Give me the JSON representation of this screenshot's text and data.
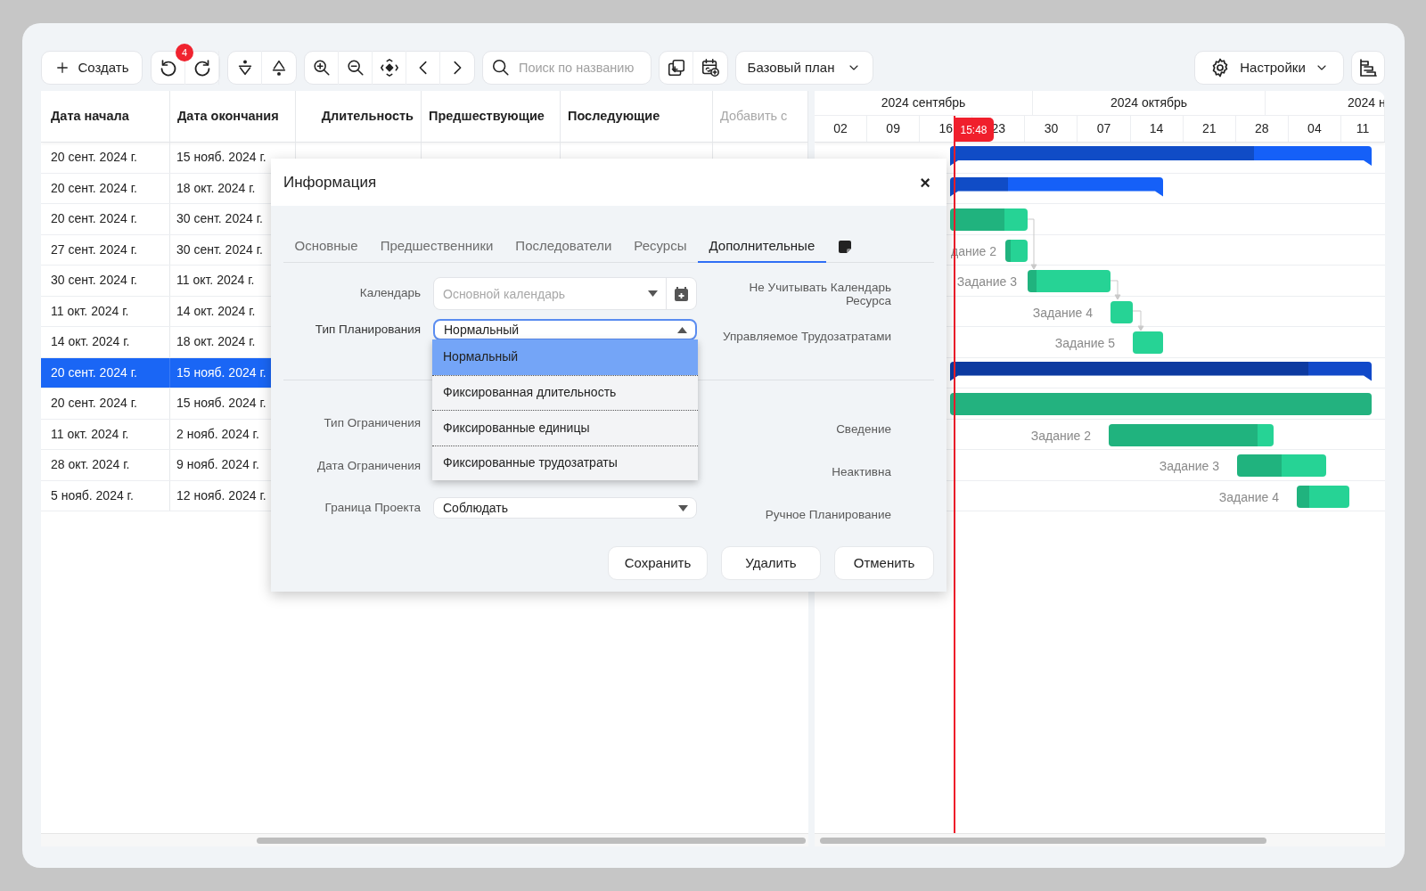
{
  "toolbar": {
    "create": "Создать",
    "undo_badge": "4",
    "search": {
      "placeholder": "Поиск по названию"
    },
    "baseline": "Базовый план",
    "settings": "Настройки"
  },
  "grid": {
    "columns": [
      "Дата начала",
      "Дата окончания",
      "Длительность",
      "Предшествующие",
      "Последующие",
      "Добавить с"
    ],
    "rows": [
      {
        "start": "20 сент. 2024 г.",
        "end": "15 нояб. 2024 г.",
        "selected": false
      },
      {
        "start": "20 сент. 2024 г.",
        "end": "18 окт. 2024 г.",
        "selected": false
      },
      {
        "start": "20 сент. 2024 г.",
        "end": "30 сент. 2024 г.",
        "selected": false
      },
      {
        "start": "27 сент. 2024 г.",
        "end": "30 сент. 2024 г.",
        "selected": false
      },
      {
        "start": "30 сент. 2024 г.",
        "end": "11 окт. 2024 г.",
        "selected": false
      },
      {
        "start": "11 окт. 2024 г.",
        "end": "14 окт. 2024 г.",
        "selected": false
      },
      {
        "start": "14 окт. 2024 г.",
        "end": "18 окт. 2024 г.",
        "selected": false
      },
      {
        "start": "20 сент. 2024 г.",
        "end": "15 нояб. 2024 г.",
        "selected": true
      },
      {
        "start": "20 сент. 2024 г.",
        "end": "15 нояб. 2024 г.",
        "selected": false
      },
      {
        "start": "11 окт. 2024 г.",
        "end": "2 нояб. 2024 г.",
        "selected": false
      },
      {
        "start": "28 окт. 2024 г.",
        "end": "9 нояб. 2024 г.",
        "selected": false
      },
      {
        "start": "5 нояб. 2024 г.",
        "end": "12 нояб. 2024 г.",
        "selected": false
      }
    ]
  },
  "gantt": {
    "months": [
      "2024 сентябрь",
      "2024 октябрь",
      "2024 н"
    ],
    "weeks": [
      "02",
      "09",
      "16",
      "23",
      "30",
      "07",
      "14",
      "21",
      "28",
      "04",
      "11"
    ],
    "now_marker": "15:48",
    "bars": [
      {
        "kind": "summary",
        "color": "#1560f8",
        "level": 0.72
      },
      {
        "kind": "summary",
        "color": "#1560f8",
        "level": 0.27
      },
      {
        "kind": "task",
        "color": "#26d395",
        "level": 0.7
      },
      {
        "kind": "task",
        "color": "#26d395",
        "level": 0.24,
        "label": "дание 2"
      },
      {
        "kind": "task",
        "color": "#26d395",
        "level": 0.11,
        "label": "Задание 3"
      },
      {
        "kind": "task",
        "color": "#26d395",
        "label": "Задание 4"
      },
      {
        "kind": "task",
        "color": "#26d395",
        "label": "Задание 5"
      },
      {
        "kind": "summary",
        "color": "#1149c9",
        "level": 0.85
      },
      {
        "kind": "task",
        "color": "#23b27f"
      },
      {
        "kind": "task",
        "color": "#26d395",
        "level": 0.9,
        "label": "Задание 2"
      },
      {
        "kind": "task",
        "color": "#26d395",
        "level": 0.5,
        "label": "Задание 3"
      },
      {
        "kind": "task",
        "color": "#26d395",
        "level": 0.24,
        "label": "Задание 4"
      }
    ]
  },
  "dialog": {
    "title": "Информация",
    "close": "×",
    "tabs": [
      {
        "kind": "text",
        "label": "Основные",
        "selected": false
      },
      {
        "kind": "text",
        "label": "Предшественники",
        "selected": false
      },
      {
        "kind": "text",
        "label": "Последователи",
        "selected": false
      },
      {
        "kind": "text",
        "label": "Ресурсы",
        "selected": false
      },
      {
        "kind": "text",
        "label": "Дополнительные",
        "selected": true
      },
      {
        "kind": "note",
        "selected": false
      }
    ],
    "calendar": {
      "label": "Календарь",
      "placeholder": "Основной календарь"
    },
    "scheduling_type": {
      "label": "Тип Планирования",
      "value": "Нормальный",
      "expanded": true,
      "options": [
        {
          "label": "Нормальный",
          "selected": true
        },
        {
          "label": "Фиксированная длительность",
          "selected": false
        },
        {
          "label": "Фиксированные единицы",
          "selected": false
        },
        {
          "label": "Фиксированные трудозатраты",
          "selected": false
        }
      ]
    },
    "constraint_type": {
      "label": "Тип Ограничения"
    },
    "constraint_date": {
      "label": "Дата Ограничения"
    },
    "project_border": {
      "label": "Граница Проекта",
      "value": "Соблюдать"
    },
    "flags": [
      "Не Учитывать Календарь Ресурса",
      "Управляемое Трудозатратами",
      "Сведение",
      "Неактивна",
      "Ручное Планирование"
    ],
    "buttons": [
      "Сохранить",
      "Удалить",
      "Отменить"
    ]
  }
}
